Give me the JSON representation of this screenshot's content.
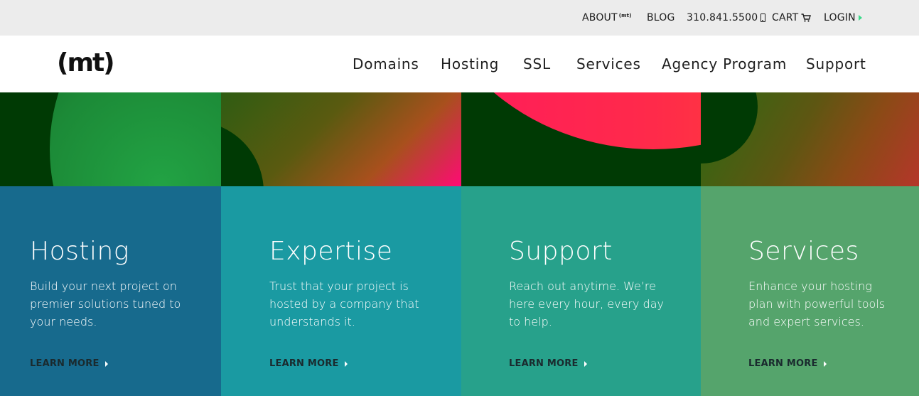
{
  "utility_nav": {
    "about": "ABOUT",
    "about_logo": "(mt)",
    "blog": "BLOG",
    "phone": "310.841.5500",
    "cart": "CART",
    "login": "LOGIN"
  },
  "header": {
    "logo": "(mt)",
    "nav": [
      "Domains",
      "Hosting",
      "SSL",
      "Services",
      "Agency Program",
      "Support"
    ]
  },
  "cards": [
    {
      "title": "Hosting",
      "text": "Build your next project on premier solutions tuned to your needs.",
      "cta": "LEARN MORE"
    },
    {
      "title": "Expertise",
      "text": "Trust that your project is hosted by a company that understands it.",
      "cta": "LEARN MORE"
    },
    {
      "title": "Support",
      "text": "Reach out anytime. We’re here every hour, every day to help.",
      "cta": "LEARN MORE"
    },
    {
      "title": "Services",
      "text": "Enhance your hosting plan with powerful tools and expert services.",
      "cta": "LEARN MORE"
    }
  ],
  "icons": {
    "phone": "phone-icon",
    "cart": "cart-icon",
    "login_arrow": "play-arrow-icon",
    "cta_arrow": "play-arrow-icon"
  },
  "colors": {
    "utility_bg": "#ececec",
    "card_hosting": "#176a8d",
    "card_expertise": "#1a9aa2",
    "card_support": "#27a18b",
    "card_services": "#55a46c",
    "accent_green": "#3bd98a"
  }
}
